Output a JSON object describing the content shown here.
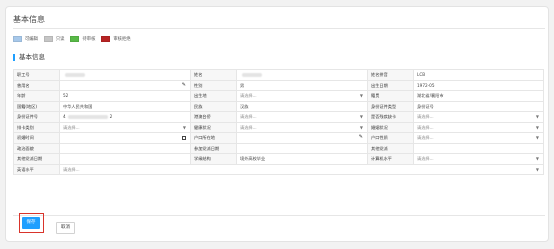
{
  "page": {
    "title": "基本信息"
  },
  "legend": [
    {
      "label": "可编辑",
      "color": "#a7c8ea"
    },
    {
      "label": "只读",
      "color": "#c6c6c6"
    },
    {
      "label": "待审核",
      "color": "#58b947"
    },
    {
      "label": "审核拒绝",
      "color": "#b82424"
    }
  ],
  "section": {
    "title": "基本信息"
  },
  "rows": [
    [
      {
        "label": "职工号",
        "value": "",
        "kind": "blur"
      },
      {
        "label": "姓名",
        "value": "",
        "kind": "blur"
      },
      {
        "label": "姓名拼音",
        "value": "LCB",
        "kind": "text"
      }
    ],
    [
      {
        "label": "曾用名",
        "value": "",
        "kind": "pencil"
      },
      {
        "label": "性别",
        "value": "男",
        "kind": "text"
      },
      {
        "label": "出生日期",
        "value": "1972-05",
        "kind": "text"
      }
    ],
    [
      {
        "label": "年龄",
        "value": "52",
        "kind": "text"
      },
      {
        "label": "出生地",
        "value": "请选择...",
        "kind": "select"
      },
      {
        "label": "籍贯",
        "value": "湖北省/襄阳市",
        "kind": "text"
      }
    ],
    [
      {
        "label": "国籍(地区)",
        "value": "中华人民共和国",
        "kind": "text"
      },
      {
        "label": "民族",
        "value": "汉族",
        "kind": "text"
      },
      {
        "label": "身份证件类型",
        "value": "身份证号",
        "kind": "text"
      }
    ],
    [
      {
        "label": "身份证件号",
        "value": "4",
        "suffix": "2",
        "kind": "masked"
      },
      {
        "label": "港澳台侨",
        "value": "请选择...",
        "kind": "select"
      },
      {
        "label": "是否残疾缺卡",
        "value": "请选择...",
        "kind": "select"
      }
    ],
    [
      {
        "label": "排卡类别",
        "value": "请选择...",
        "kind": "select"
      },
      {
        "label": "健康状况",
        "value": "请选择...",
        "kind": "select"
      },
      {
        "label": "婚姻状况",
        "value": "请选择...",
        "kind": "select"
      }
    ],
    [
      {
        "label": "初婚时间",
        "value": "",
        "kind": "date"
      },
      {
        "label": "户口所在地",
        "value": "",
        "kind": "pencil"
      },
      {
        "label": "户口性质",
        "value": "请选择...",
        "kind": "select"
      }
    ],
    [
      {
        "label": "政治面貌",
        "value": "",
        "kind": "text"
      },
      {
        "label": "参加党派日期",
        "value": "",
        "kind": "text"
      },
      {
        "label": "其他党派",
        "value": "",
        "kind": "text"
      }
    ],
    [
      {
        "label": "其他党派日期",
        "value": "",
        "kind": "text"
      },
      {
        "label": "学缘结构",
        "value": "境外高校毕业",
        "kind": "text"
      },
      {
        "label": "计算机水平",
        "value": "请选择...",
        "kind": "select"
      }
    ]
  ],
  "last_row": {
    "label": "英语水平",
    "value": "请选择..."
  },
  "buttons": {
    "save": "保存",
    "cancel": "取消"
  }
}
